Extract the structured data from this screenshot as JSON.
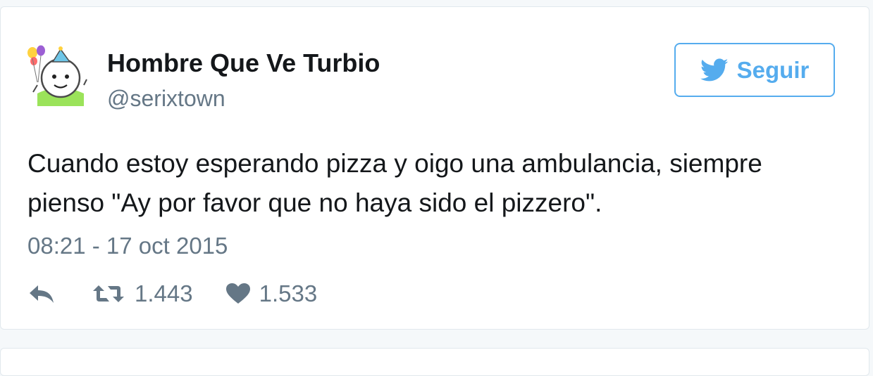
{
  "tweet": {
    "author": {
      "display_name": "Hombre Que Ve Turbio",
      "handle": "@serixtown",
      "avatar_icon": "party-face-with-balloons-icon"
    },
    "follow_button": {
      "label": "Seguir",
      "icon": "twitter-bird-icon",
      "color": "#55acee"
    },
    "text": "Cuando estoy esperando pizza y oigo una ambulancia, siempre pienso \"Ay por favor que no haya sido el pizzero\".",
    "timestamp": "08:21 - 17 oct 2015",
    "actions": {
      "reply": {
        "icon": "reply-icon"
      },
      "retweet": {
        "icon": "retweet-icon",
        "count": "1.443"
      },
      "like": {
        "icon": "heart-icon",
        "count": "1.533"
      }
    }
  },
  "colors": {
    "text_primary": "#14171a",
    "text_secondary": "#657786",
    "accent": "#55acee",
    "border": "#e1e8ed"
  }
}
